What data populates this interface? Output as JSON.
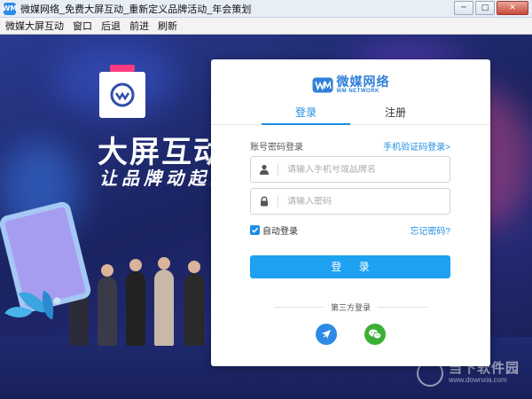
{
  "window": {
    "title": "微媒网络_免费大屏互动_重新定义品牌活动_年会策划",
    "app_icon_text": "WM",
    "min_glyph": "─",
    "max_glyph": "□",
    "close_glyph": "✕"
  },
  "menu": {
    "items": [
      "微媒大屏互动",
      "窗口",
      "后退",
      "前进",
      "刷新"
    ]
  },
  "background": {
    "headline": "大屏互动",
    "subline": "让品牌动起来"
  },
  "login": {
    "brand_name": "微媒网络",
    "brand_en": "WM NETWORK",
    "tabs": [
      "登录",
      "注册"
    ],
    "active_tab": "登录",
    "section_label": "账号密码登录",
    "sms_login_link": "手机验证码登录>",
    "account_placeholder": "请输入手机号或品牌名",
    "password_placeholder": "请输入密码",
    "auto_login_label": "自动登录",
    "auto_login_checked": true,
    "forgot_password_link": "忘记密码?",
    "login_button": "登 录",
    "third_party_label": "第三方登录"
  },
  "watermark": {
    "text": "当下软件园",
    "url": "www.downxia.com"
  },
  "colors": {
    "accent": "#1e8de3",
    "button": "#1ea1f1",
    "qq": "#2e8ae6",
    "wechat": "#3cb034"
  }
}
